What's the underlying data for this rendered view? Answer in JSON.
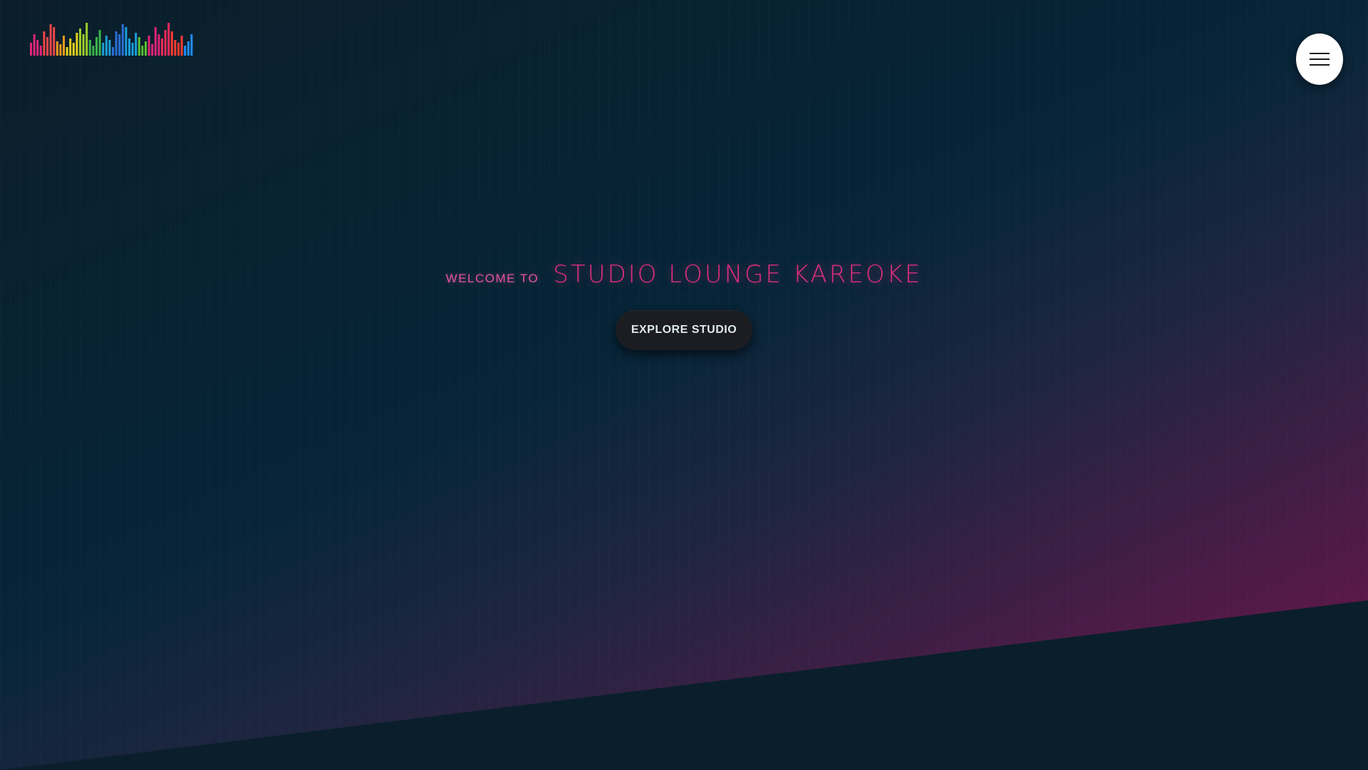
{
  "header": {
    "logo_icon": "equalizer-bars-logo",
    "menu_icon": "hamburger-menu-icon"
  },
  "hero": {
    "welcome_label": "WELCOME TO",
    "title": "STUDIO LOUNGE KAREOKE",
    "cta_label": "EXPLORE STUDIO"
  },
  "colors": {
    "background_dark": "#08202c",
    "background_teal": "#062538",
    "accent_pink": "#e02e7d",
    "gradient_magenta": "#7a1550",
    "button_dark": "#1b1d22",
    "menu_button_bg": "#ffffff"
  }
}
